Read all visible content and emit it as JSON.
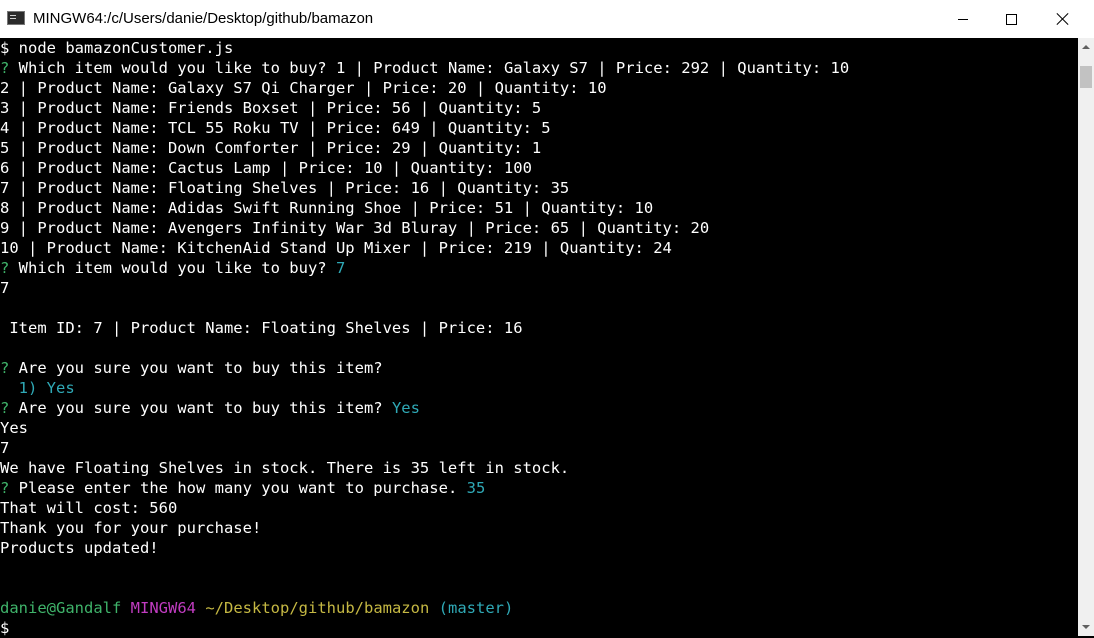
{
  "window": {
    "title": "MINGW64:/c/Users/danie/Desktop/github/bamazon",
    "icon": "terminal-icon"
  },
  "terminal": {
    "command_line": "$ node bamazonCustomer.js",
    "q1_prompt_mark": "?",
    "q1_text": " Which item would you like to buy? ",
    "q1_first_item": "1 | Product Name: Galaxy S7 | Price: 292 | Quantity: 10",
    "items": [
      "2 | Product Name: Galaxy S7 Qi Charger | Price: 20 | Quantity: 10",
      "3 | Product Name: Friends Boxset | Price: 56 | Quantity: 5",
      "4 | Product Name: TCL 55 Roku TV | Price: 649 | Quantity: 5",
      "5 | Product Name: Down Comforter | Price: 29 | Quantity: 1",
      "6 | Product Name: Cactus Lamp | Price: 10 | Quantity: 100",
      "7 | Product Name: Floating Shelves | Price: 16 | Quantity: 35",
      "8 | Product Name: Adidas Swift Running Shoe | Price: 51 | Quantity: 10",
      "9 | Product Name: Avengers Infinity War 3d Bluray | Price: 65 | Quantity: 20",
      "10 | Product Name: KitchenAid Stand Up Mixer | Price: 219 | Quantity: 24"
    ],
    "q2_prompt_mark": "?",
    "q2_text": " Which item would you like to buy? ",
    "q2_answer": "7",
    "echo_id": "7",
    "selected_item": " Item ID: 7 | Product Name: Floating Shelves | Price: 16",
    "q3_prompt_mark": "?",
    "q3_text": " Are you sure you want to buy this item?",
    "q3_choice": "  1) Yes",
    "q4_prompt_mark": "?",
    "q4_text": " Are you sure you want to buy this item? ",
    "q4_answer": "Yes",
    "echo_yes": "Yes",
    "echo_id2": "7",
    "stock_message": "We have Floating Shelves in stock. There is 35 left in stock.",
    "q5_prompt_mark": "?",
    "q5_text": " Please enter the how many you want to purchase. ",
    "q5_answer": "35",
    "cost_line": "That will cost: 560",
    "thanks_line": "Thank you for your purchase!",
    "updated_line": "Products updated!",
    "prompt": {
      "user_host": "danie@Gandalf",
      "system": "MINGW64",
      "path": "~/Desktop/github/bamazon",
      "branch": "(master)",
      "dollar": "$"
    }
  },
  "colors": {
    "background": "#000000",
    "text": "#ffffff",
    "prompt_mark": "#3fb36a",
    "answer": "#2fa9b6",
    "user_host": "#3fb36a",
    "system": "#c13cc1",
    "path": "#c5b843",
    "branch": "#2fa9b6"
  }
}
